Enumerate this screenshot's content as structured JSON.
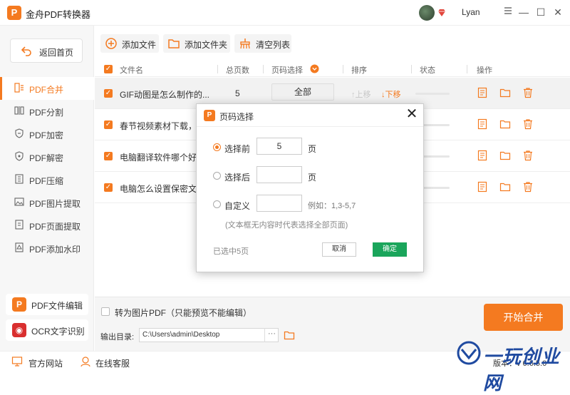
{
  "app": {
    "title": "金舟PDF转换器",
    "logo_letter": "P",
    "username": "Lyan"
  },
  "window": {
    "min": "—",
    "restore": "◫",
    "max": "☐",
    "close": "✕"
  },
  "sidebar": {
    "home_label": "返回首页",
    "items": [
      {
        "label": "PDF合并",
        "icon": "merge-icon",
        "active": true
      },
      {
        "label": "PDF分割",
        "icon": "split-icon"
      },
      {
        "label": "PDF加密",
        "icon": "lock-shield-icon"
      },
      {
        "label": "PDF解密",
        "icon": "unlock-shield-icon"
      },
      {
        "label": "PDF压缩",
        "icon": "compress-icon"
      },
      {
        "label": "PDF图片提取",
        "icon": "image-extract-icon"
      },
      {
        "label": "PDF页面提取",
        "icon": "page-extract-icon"
      },
      {
        "label": "PDF添加水印",
        "icon": "watermark-icon"
      }
    ],
    "tools": [
      {
        "label": "PDF文件编辑",
        "icon_letter": "P",
        "color": "#f47a20"
      },
      {
        "label": "OCR文字识别",
        "icon_letter": "◉",
        "color": "#d92f2f"
      }
    ]
  },
  "toolbar": {
    "add_file": "添加文件",
    "add_folder": "添加文件夹",
    "clear_list": "清空列表"
  },
  "table": {
    "headers": {
      "name": "文件名",
      "total_pages": "总页数",
      "page_select": "页码选择",
      "sort": "排序",
      "status": "状态",
      "actions": "操作"
    },
    "rows": [
      {
        "name": "GIF动图是怎么制作的...",
        "pages": "5",
        "range": "全部",
        "up": "↑上移",
        "down": "↓下移"
      },
      {
        "name": "春节视频素材下载，..."
      },
      {
        "name": "电脑翻译软件哪个好..."
      },
      {
        "name": "电脑怎么设置保密文..."
      }
    ]
  },
  "footer": {
    "convert_label": "转为图片PDF（只能预览不能编辑）",
    "output_label": "输出目录:",
    "output_path": "C:\\Users\\admin\\Desktop",
    "browse": "···",
    "start_button": "开始合并"
  },
  "statusbar": {
    "website": "官方网站",
    "service": "在线客服",
    "version": "版本：v 6.6.5.0"
  },
  "dialog": {
    "title": "页码选择",
    "close": "✕",
    "options": [
      {
        "label": "选择前",
        "value": "5",
        "unit": "页",
        "checked": true
      },
      {
        "label": "选择后",
        "value": "",
        "unit": "页",
        "checked": false
      },
      {
        "label": "自定义",
        "value": "",
        "example": "例如：1,3-5,7",
        "checked": false
      }
    ],
    "hint": "(文本框无内容时代表选择全部页面)",
    "selected_count": "已选中5页",
    "cancel": "取消",
    "ok": "确定"
  },
  "watermark": {
    "text": "一玩创业网"
  },
  "colors": {
    "accent": "#f47a20",
    "confirm": "#1aa55b",
    "ocr": "#d92f2f"
  }
}
